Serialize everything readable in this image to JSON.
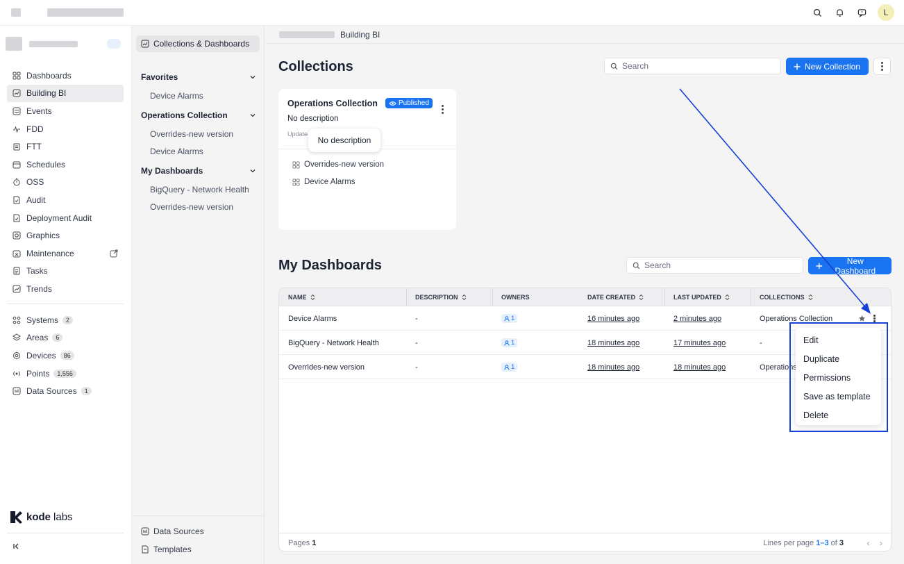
{
  "topbar": {
    "icons": [
      "search-icon",
      "bell-icon",
      "chat-icon"
    ],
    "user_initial": "L"
  },
  "sidebar": {
    "nav": [
      {
        "label": "Dashboards",
        "icon": "grid-icon"
      },
      {
        "label": "Building BI",
        "icon": "chart-icon",
        "active": true
      },
      {
        "label": "Events",
        "icon": "list-icon"
      },
      {
        "label": "FDD",
        "icon": "pulse-icon"
      },
      {
        "label": "FTT",
        "icon": "clipboard-icon"
      },
      {
        "label": "Schedules",
        "icon": "calendar-icon"
      },
      {
        "label": "OSS",
        "icon": "timer-icon"
      },
      {
        "label": "Audit",
        "icon": "audit-icon"
      },
      {
        "label": "Deployment Audit",
        "icon": "audit-icon"
      },
      {
        "label": "Graphics",
        "icon": "image-icon"
      },
      {
        "label": "Maintenance",
        "icon": "wrench-icon",
        "external": true
      },
      {
        "label": "Tasks",
        "icon": "tasks-icon"
      },
      {
        "label": "Trends",
        "icon": "trend-icon"
      }
    ],
    "resources": [
      {
        "label": "Systems",
        "badge": "2",
        "icon": "systems-icon"
      },
      {
        "label": "Areas",
        "badge": "6",
        "icon": "layers-icon"
      },
      {
        "label": "Devices",
        "badge": "86",
        "icon": "device-icon"
      },
      {
        "label": "Points",
        "badge": "1,556",
        "icon": "points-icon"
      },
      {
        "label": "Data Sources",
        "badge": "1",
        "icon": "datasource-icon"
      }
    ],
    "logo_bold": "kode",
    "logo_light": "labs",
    "collapse": "K"
  },
  "panel": {
    "header": "Collections & Dashboards",
    "sections": [
      {
        "title": "Favorites",
        "items": [
          "Device Alarms"
        ]
      },
      {
        "title": "Operations Collection",
        "items": [
          "Overrides-new version",
          "Device Alarms"
        ]
      },
      {
        "title": "My Dashboards",
        "items": [
          "BigQuery - Network Health",
          "Overrides-new version"
        ]
      }
    ],
    "footer": [
      "Data Sources",
      "Templates"
    ]
  },
  "main": {
    "breadcrumb": "Building BI",
    "collections": {
      "title": "Collections",
      "search_placeholder": "Search",
      "new_button": "New Collection",
      "card": {
        "title": "Operations Collection",
        "badge": "Published",
        "description": "No description",
        "updated": "Update",
        "items": [
          "Overrides-new version",
          "Device Alarms"
        ],
        "tooltip": "No description"
      }
    },
    "dashboards": {
      "title": "My Dashboards",
      "search_placeholder": "Search",
      "new_button": "New Dashboard",
      "columns": [
        "NAME",
        "DESCRIPTION",
        "OWNERS",
        "DATE CREATED",
        "LAST UPDATED",
        "COLLECTIONS"
      ],
      "rows": [
        {
          "name": "Device Alarms",
          "description": "-",
          "owners": "1",
          "created": "16 minutes ago",
          "updated": "2 minutes ago",
          "collections": "Operations Collection"
        },
        {
          "name": "BigQuery - Network Health",
          "description": "-",
          "owners": "1",
          "created": "18 minutes ago",
          "updated": "17 minutes ago",
          "collections": "-"
        },
        {
          "name": "Overrides-new version",
          "description": "-",
          "owners": "1",
          "created": "18 minutes ago",
          "updated": "18 minutes ago",
          "collections": "Operations"
        }
      ],
      "footer": {
        "pages_label": "Pages",
        "pages_value": "1",
        "lines_label": "Lines per page",
        "range": "1–3",
        "of": "of",
        "total": "3"
      }
    },
    "context_menu": [
      "Edit",
      "Duplicate",
      "Permissions",
      "Save as template",
      "Delete"
    ]
  },
  "colors": {
    "primary": "#1a73f0",
    "annotation": "#1640d6"
  }
}
